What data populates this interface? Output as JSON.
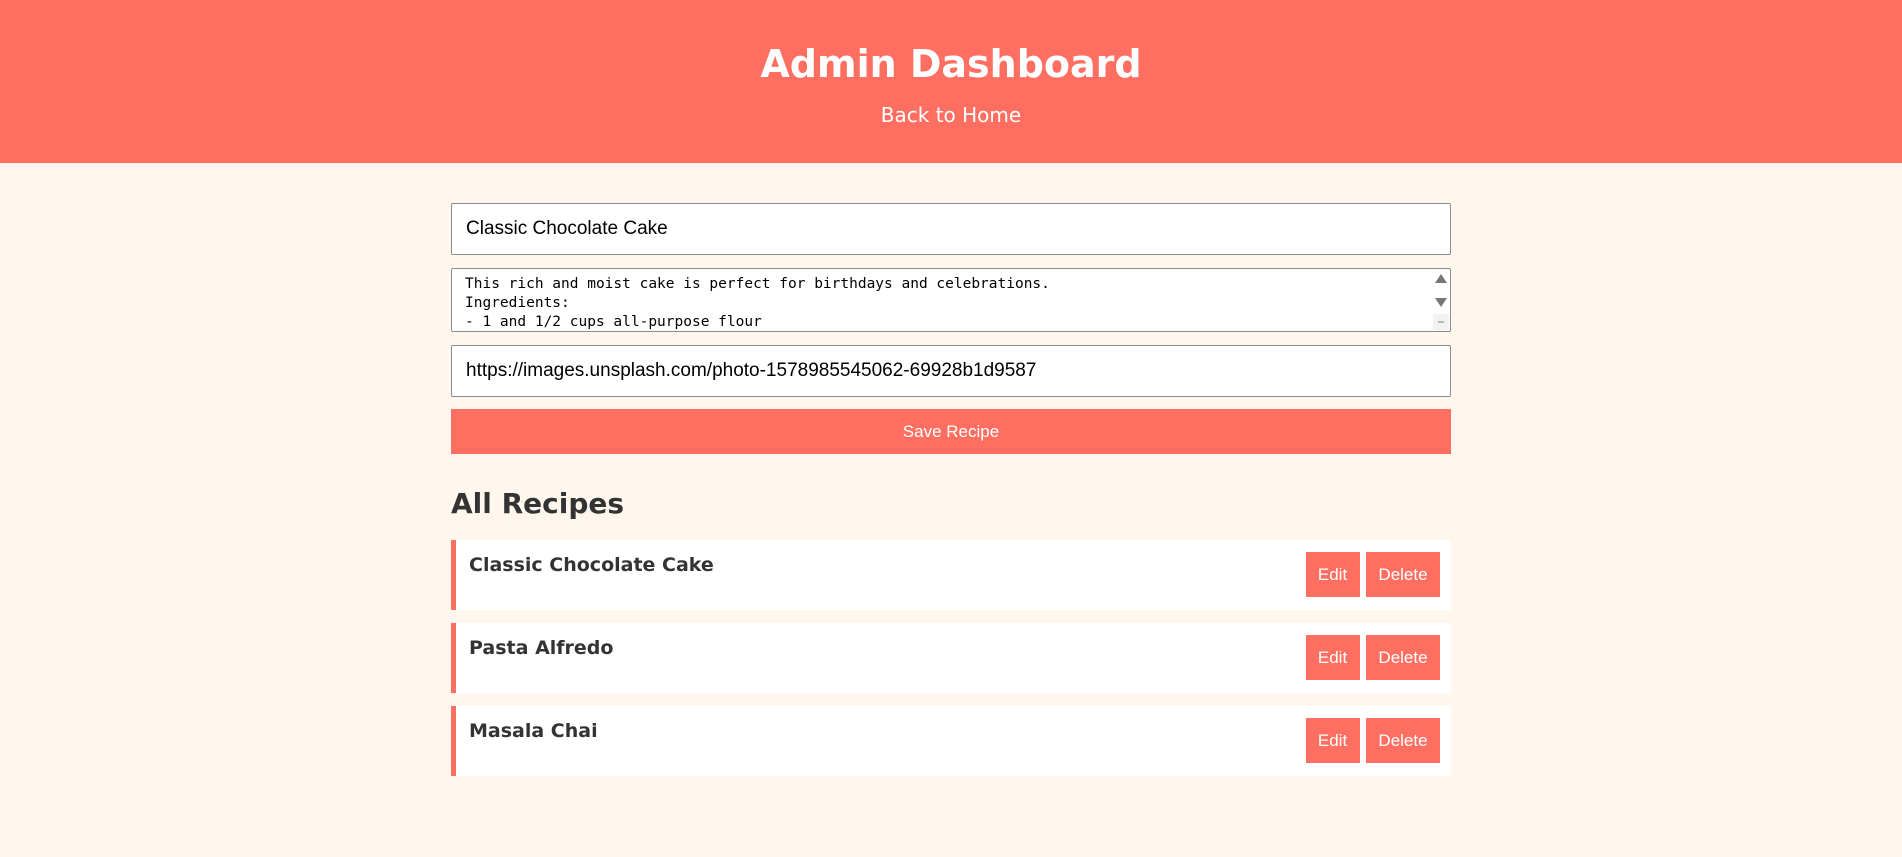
{
  "header": {
    "title": "Admin Dashboard",
    "back_link": "Back to Home",
    "accent_color": "#ff6f61",
    "background_color": "#fff7ee"
  },
  "form": {
    "title_value": "Classic Chocolate Cake",
    "description_value": "This rich and moist cake is perfect for birthdays and celebrations.\nIngredients:\n- 1 and 1/2 cups all-purpose flour",
    "image_url_value": "https://images.unsplash.com/photo-1578985545062-69928b1d9587",
    "save_label": "Save Recipe"
  },
  "recipes_section": {
    "title": "All Recipes",
    "edit_label": "Edit",
    "delete_label": "Delete",
    "items": [
      {
        "title": "Classic Chocolate Cake"
      },
      {
        "title": "Pasta Alfredo"
      },
      {
        "title": "Masala Chai"
      }
    ]
  }
}
